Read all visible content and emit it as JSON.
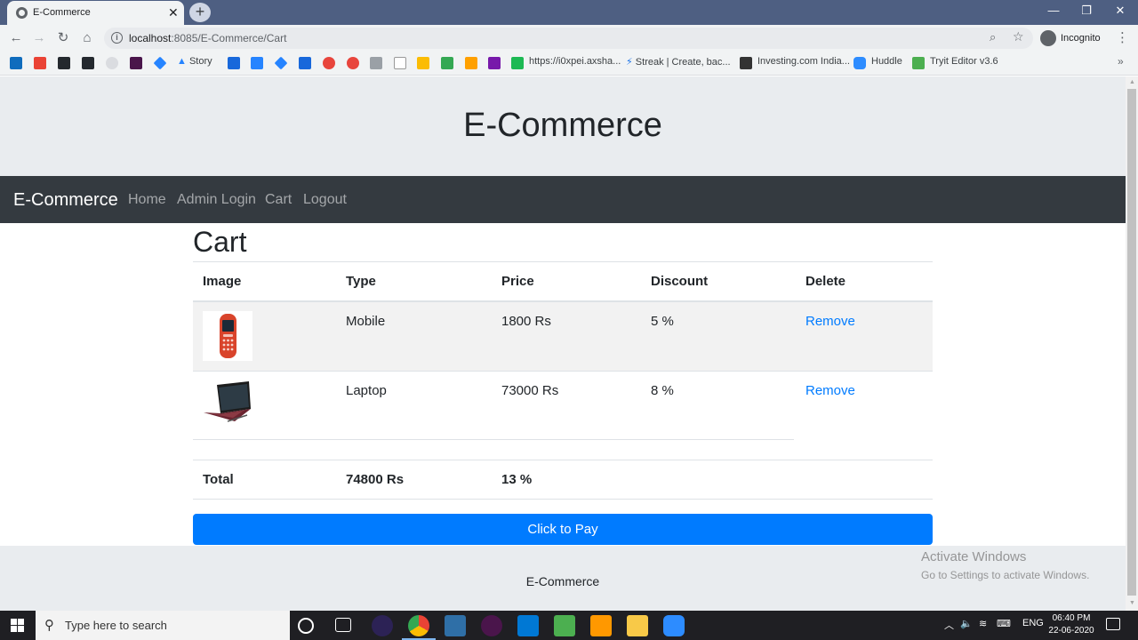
{
  "browser": {
    "tab_title": "E-Commerce",
    "url_host": "localhost",
    "url_rest": ":8085/E-Commerce/Cart",
    "profile_label": "Incognito",
    "bookmarks": [
      {
        "label": "Story"
      },
      {
        "label": "https://i0xpei.axsha..."
      },
      {
        "label": "Streak | Create, bac..."
      },
      {
        "label": "Investing.com India..."
      },
      {
        "label": "Huddle"
      },
      {
        "label": "Tryit Editor v3.6"
      }
    ]
  },
  "page": {
    "header_title": "E-Commerce",
    "nav": {
      "brand": "E-Commerce",
      "links": [
        "Home",
        "Admin Login",
        "Cart",
        "Logout"
      ]
    },
    "cart": {
      "title": "Cart",
      "columns": [
        "Image",
        "Type",
        "Price",
        "Discount",
        "Delete"
      ],
      "items": [
        {
          "type": "Mobile",
          "price": "1800 Rs",
          "discount": "5 %",
          "action": "Remove"
        },
        {
          "type": "Laptop",
          "price": "73000 Rs",
          "discount": "8 %",
          "action": "Remove"
        }
      ],
      "total_label": "Total",
      "total_price": "74800 Rs",
      "total_discount": "13 %"
    },
    "pay_button": "Click to Pay",
    "footer": "E-Commerce"
  },
  "watermark": {
    "line1": "Activate Windows",
    "line2": "Go to Settings to activate Windows."
  },
  "taskbar": {
    "search_placeholder": "Type here to search",
    "language": "ENG",
    "time": "06:40 PM",
    "date": "22-06-2020"
  },
  "colors": {
    "primary": "#007bff",
    "navbar": "#343a40",
    "jumbotron": "#e9ecef"
  }
}
